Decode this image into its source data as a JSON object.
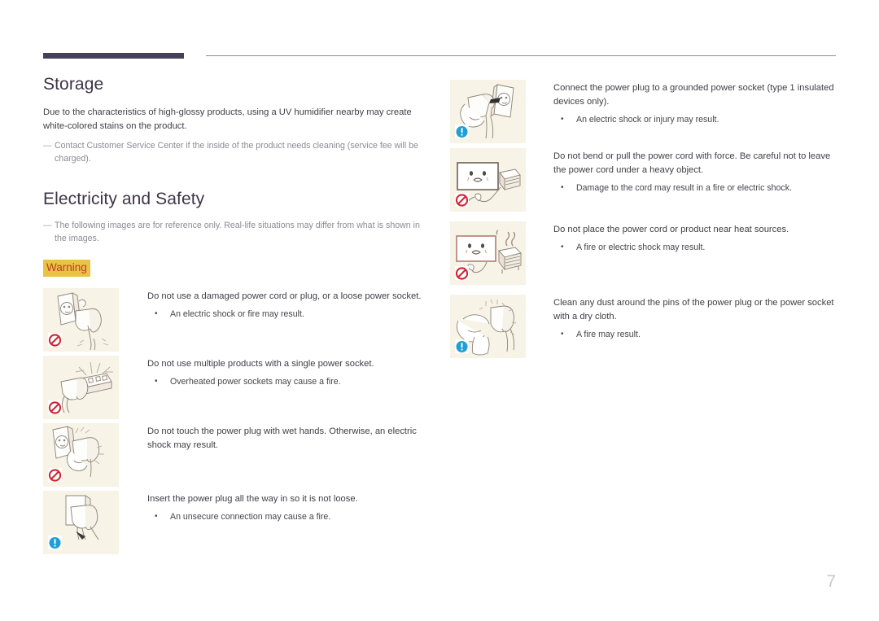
{
  "page": {
    "number": "7",
    "accent_bar_color": "#45415a",
    "heading_color": "#3c3546",
    "illustration_bg": "#f7f3e6",
    "warning_bg": "#e9c344",
    "warning_fg": "#c0392b",
    "prohibit_color": "#cf2434",
    "info_color": "#1f9fd6"
  },
  "left_column": {
    "storage": {
      "title": "Storage",
      "body": "Due to the characteristics of high-glossy products, using a UV humidifier nearby may create white-colored stains on the product.",
      "note_dash": "—",
      "note": "Contact Customer Service Center if the inside of the product needs cleaning (service fee will be charged)."
    },
    "electricity": {
      "title": "Electricity and Safety",
      "note_dash": "—",
      "note": "The following images are for reference only. Real-life situations may differ from what is shown in the images.",
      "warning_label": "Warning"
    },
    "items": [
      {
        "icon": "prohibition-icon",
        "illustration": "damaged-power-plug-illustration",
        "lead": "Do not use a damaged power cord or plug, or a loose power socket.",
        "bullet_marker": "•",
        "bullet": "An electric shock or fire may result."
      },
      {
        "icon": "prohibition-icon",
        "illustration": "multiple-products-power-strip-illustration",
        "lead": "Do not use multiple products with a single power socket.",
        "bullet_marker": "•",
        "bullet": "Overheated power sockets may cause a fire."
      },
      {
        "icon": "prohibition-icon",
        "illustration": "wet-hands-plug-illustration",
        "lead": "Do not touch the power plug with wet hands. Otherwise, an electric shock may result.",
        "bullet_marker": "",
        "bullet": ""
      },
      {
        "icon": "info-icon",
        "illustration": "insert-plug-fully-illustration",
        "lead": "Insert the power plug all the way in so it is not loose.",
        "bullet_marker": "•",
        "bullet": "An unsecure connection may cause a fire."
      }
    ]
  },
  "right_column": {
    "items": [
      {
        "icon": "info-icon",
        "illustration": "grounded-socket-illustration",
        "lead": "Connect the power plug to a grounded power socket (type 1 insulated devices only).",
        "bullet_marker": "•",
        "bullet": "An electric shock or injury may result."
      },
      {
        "icon": "prohibition-icon",
        "illustration": "bend-pull-cord-heavy-object-illustration",
        "lead": "Do not bend or pull the power cord with force. Be careful not to leave the power cord under a heavy object.",
        "bullet_marker": "•",
        "bullet": "Damage to the cord may result in a fire or electric shock."
      },
      {
        "icon": "prohibition-icon",
        "illustration": "cord-near-heat-source-illustration",
        "lead": "Do not place the power cord or product near heat sources.",
        "bullet_marker": "•",
        "bullet": "A fire or electric shock may result."
      },
      {
        "icon": "info-icon",
        "illustration": "clean-dust-from-plug-illustration",
        "lead": "Clean any dust around the pins of the power plug or the power socket with a dry cloth.",
        "bullet_marker": "•",
        "bullet": "A fire may result."
      }
    ]
  }
}
